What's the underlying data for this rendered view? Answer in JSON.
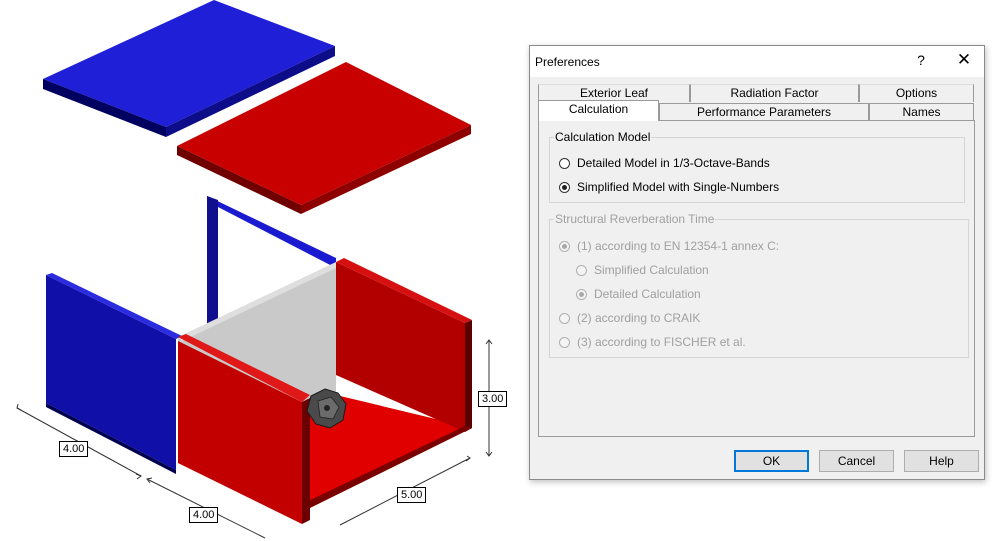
{
  "scene": {
    "dimensions": {
      "width_a": "4.00",
      "width_b": "4.00",
      "depth": "5.00",
      "height": "3.00"
    },
    "colors": {
      "blue": "#1c1ccf",
      "red": "#d00000",
      "grey": "#c9c9c9"
    },
    "object_icon": "dodecahedron-sound-source-icon"
  },
  "dialog": {
    "title": "Preferences",
    "help_glyph": "?",
    "close_glyph": "✕",
    "tabs_back": [
      "Exterior Leaf",
      "Radiation Factor",
      "Options"
    ],
    "tabs_front": [
      "Calculation",
      "Performance Parameters",
      "Names"
    ],
    "active_tab": "Calculation",
    "calculation_model": {
      "legend": "Calculation Model",
      "options": [
        "Detailed Model in 1/3-Octave-Bands",
        "Simplified Model with Single-Numbers"
      ],
      "selected": 1
    },
    "reverberation": {
      "legend": "Structural Reverberation Time",
      "enabled": false,
      "options": [
        "(1) according to EN 12354-1 annex C:",
        "Simplified Calculation",
        "Detailed Calculation",
        "(2) according to CRAIK",
        "(3) according to FISCHER et al."
      ],
      "selected": [
        0,
        2
      ]
    },
    "buttons": {
      "ok": "OK",
      "cancel": "Cancel",
      "help": "Help"
    }
  }
}
